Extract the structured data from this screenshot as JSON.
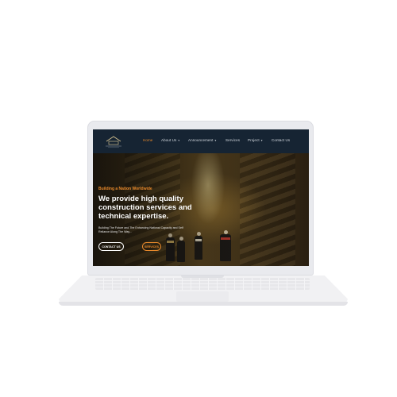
{
  "navbar": {
    "logo_name": "company-logo",
    "items": [
      {
        "label": "Home",
        "active": true,
        "dropdown": false
      },
      {
        "label": "About Us",
        "active": false,
        "dropdown": true
      },
      {
        "label": "Announcement",
        "active": false,
        "dropdown": true
      },
      {
        "label": "Services",
        "active": false,
        "dropdown": false
      },
      {
        "label": "Project",
        "active": false,
        "dropdown": true
      },
      {
        "label": "Contact Us",
        "active": false,
        "dropdown": false
      }
    ],
    "caret": "▾"
  },
  "hero": {
    "subtitle": "Building a Nation Worldwide",
    "title": "We provide high quality construction services and technical expertise.",
    "text": "Building The Future and The Enhancing National Capacity and Self Reliance Along The Way...",
    "buttons": {
      "contact": "CONTACT US",
      "services": "SERVICES"
    }
  },
  "colors": {
    "accent": "#e8892b",
    "navbar": "#162433",
    "laptop_body": "#e9eaee"
  }
}
